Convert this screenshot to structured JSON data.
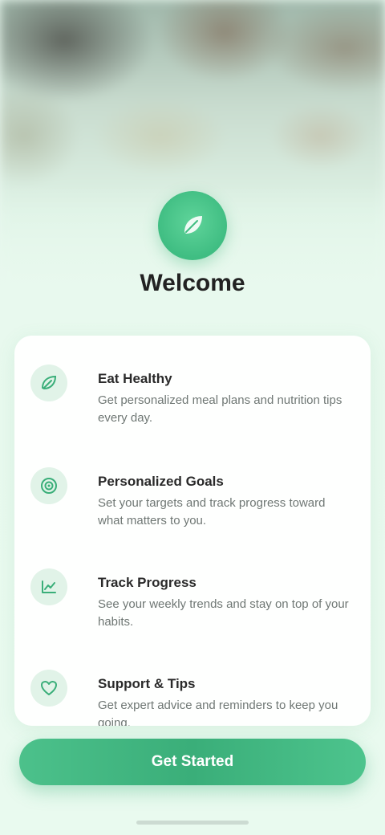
{
  "title": "Welcome",
  "features": [
    {
      "icon": "leaf-icon",
      "title": "Eat Healthy",
      "description": "Get personalized meal plans and nutrition tips every day."
    },
    {
      "icon": "target-icon",
      "title": "Personalized Goals",
      "description": "Set your targets and track progress toward what matters to you."
    },
    {
      "icon": "chart-icon",
      "title": "Track Progress",
      "description": "See your weekly trends and stay on top of your habits."
    },
    {
      "icon": "heart-icon",
      "title": "Support & Tips",
      "description": "Get expert advice and reminders to keep you going."
    }
  ],
  "cta_label": "Get Started",
  "colors": {
    "accent": "#3fbd82",
    "accent_dark": "#3aae79",
    "background": "#e9f9ee"
  }
}
